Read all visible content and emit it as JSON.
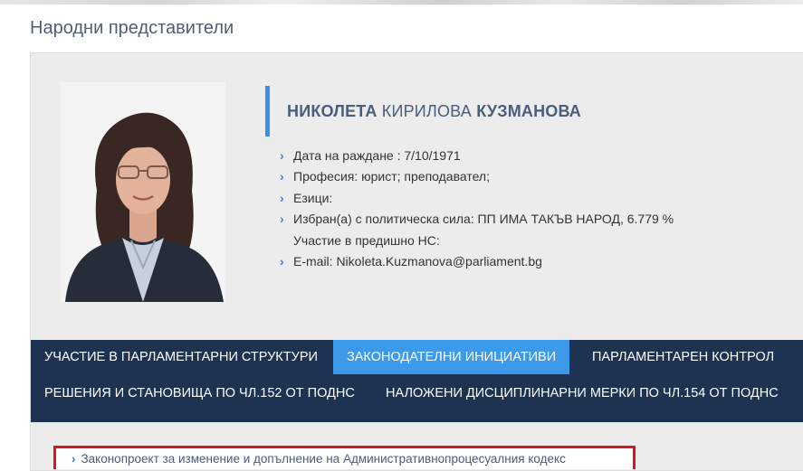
{
  "page": {
    "title": "Народни представители"
  },
  "profile": {
    "first_name": "НИКОЛЕТА",
    "middle_name": "КИРИЛОВА",
    "last_name": "КУЗМАНОВА",
    "details": [
      {
        "text": "Дата на раждане : 7/10/1971",
        "has_icon": true
      },
      {
        "text": "Професия: юрист; преподавател;",
        "has_icon": true
      },
      {
        "text": "Езици:",
        "has_icon": true
      },
      {
        "text": "Избран(а) с политическа сила: ПП ИМА ТАКЪВ НАРОД, 6.779 %",
        "has_icon": true
      },
      {
        "text": "Участие в предишно НС:",
        "has_icon": false
      },
      {
        "text": "E-mail: Nikoleta.Kuzmanova@parliament.bg",
        "has_icon": true
      }
    ]
  },
  "tabs": [
    {
      "label": "Участие в парламентарни структури",
      "active": false
    },
    {
      "label": "Законодателни инициативи",
      "active": true
    },
    {
      "label": "Парламентарен контрол",
      "active": false
    },
    {
      "label": "Решения и становища по чл.152 от ПОДНС",
      "active": false
    },
    {
      "label": "Наложени дисциплинарни мерки по чл.154 от ПОДНС",
      "active": false
    }
  ],
  "results": [
    {
      "label": "Законопроект за изменение и допълнение на Административнопроцесуалния кодекс"
    }
  ],
  "colors": {
    "accent": "#3d99ea",
    "nav_bg": "#1e3352",
    "highlight_border": "#d21a1a"
  }
}
